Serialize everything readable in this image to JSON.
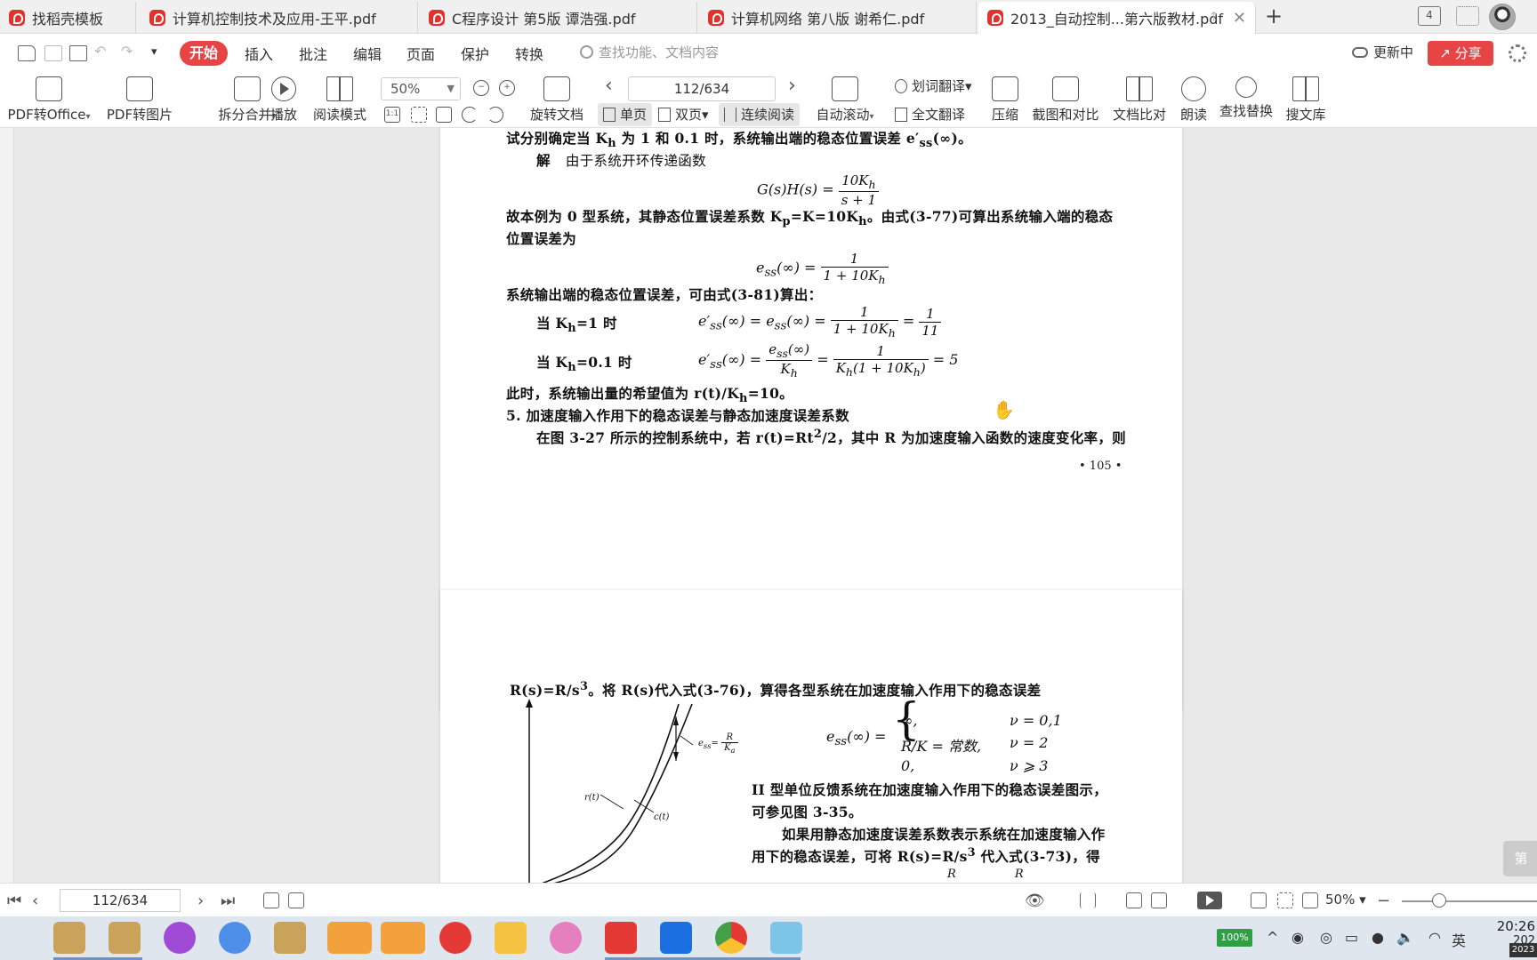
{
  "tabs": [
    {
      "title": "找稻壳模板",
      "active": false
    },
    {
      "title": "计算机控制技术及应用-王平.pdf",
      "active": false
    },
    {
      "title": "C程序设计 第5版 谭浩强.pdf",
      "active": false
    },
    {
      "title": "计算机网络 第八版 谢希仁.pdf",
      "active": false
    },
    {
      "title": "2013_自动控制...第六版教材.pdf",
      "active": true
    }
  ],
  "window": {
    "tab_count": "4"
  },
  "menu": {
    "items": [
      "开始",
      "插入",
      "批注",
      "编辑",
      "页面",
      "保护",
      "转换"
    ],
    "search_placeholder": "查找功能、文档内容",
    "updating": "更新中",
    "share": "分享"
  },
  "toolbar": {
    "pdf_to_office": "PDF转Office",
    "pdf_to_image": "PDF转图片",
    "split_merge": "拆分合并",
    "play": "播放",
    "read_mode": "阅读模式",
    "zoom": "50%",
    "rotate": "旋转文档",
    "page_indicator": "112/634",
    "single_page": "单页",
    "double_page": "双页",
    "continuous": "连续阅读",
    "auto_scroll": "自动滚动",
    "word_translate": "划词翻译",
    "full_translate": "全文翻译",
    "compress": "压缩",
    "screenshot_compare": "截图和对比",
    "doc_compare": "文档比对",
    "read_aloud": "朗读",
    "find_replace": "查找替换",
    "search_library": "搜文库"
  },
  "document": {
    "page1": {
      "line1": "试分别确定当 K",
      "line1b": "h",
      "line1c": " 为 1 和 0.1 时，系统输出端的稳态位置误差 e′",
      "line1d": "ss",
      "line1e": "(∞)。",
      "solution_label": "解",
      "solution_text": "由于系统开环传递函数",
      "eq1_lhs": "G(s)H(s) = ",
      "eq1_num": "10K",
      "eq1_den": "s + 1",
      "para2": "故本例为 0 型系统，其静态位置误差系数 K",
      "para2b": "p",
      "para2c": "=K=10K",
      "para2d": "h",
      "para2e": "。由式(3-77)可算出系统输入端的稳态",
      "para2_line2": "位置误差为",
      "eq2_lhs": "e",
      "eq2_sub": "ss",
      "eq2_mid": "(∞) = ",
      "eq2_num": "1",
      "eq2_den": "1 + 10K",
      "para3": "系统输出端的稳态位置误差，可由式(3-81)算出：",
      "case1_label": "当 K",
      "case1_cond": "=1 时",
      "case1_eq": "e′",
      "case1_eq2": "(∞) = e",
      "case1_eq3": "(∞) = ",
      "case1_num1": "1",
      "case1_den1": "1 + 10K",
      "case1_num2": "1",
      "case1_den2": "11",
      "case2_label": "当 K",
      "case2_cond": "=0.1 时",
      "case2_eq": "e′",
      "case2_eq2": "(∞) = ",
      "case2_num1": "e",
      "case2_num1b": "(∞)",
      "case2_den1": "K",
      "case2_num2": "1",
      "case2_den2": "K",
      "case2_den2b": "(1 + 10K",
      "case2_den2c": ")",
      "case2_result": " = 5",
      "para4": "此时，系统输出量的希望值为 r(t)/K",
      "para4b": "h",
      "para4c": "=10。",
      "section5": "5. 加速度输入作用下的稳态误差与静态加速度误差系数",
      "para5": "在图 3-27 所示的控制系统中，若 r(t)=Rt",
      "para5b": "2",
      "para5c": "/2，其中 R 为加速度输入函数的速度变化率，则",
      "page_number": "• 105 •"
    },
    "page2": {
      "line1": "R(s)=R/s",
      "line1b": "3",
      "line1c": "。将 R(s)代入式(3-76)，算得各型系统在加速度输入作用下的稳态误差",
      "eq_lhs": "e",
      "eq_sub": "ss",
      "eq_mid": "(∞) =",
      "case_a": "∞,",
      "case_a_cond": "ν = 0,1",
      "case_b": "R/K = 常数,",
      "case_b_cond": "ν = 2",
      "case_c": "0,",
      "case_c_cond": "ν ⩾ 3",
      "para_a": "II 型单位反馈系统在加速度输入作用下的稳态误差图示，",
      "para_a2": "可参见图 3-35。",
      "para_b": "如果用静态加速度误差系数表示系统在加速度输入作",
      "para_b2": "用下的稳态误差，可将 R(s)=R/s",
      "para_b2b": "3",
      "para_b2c": " 代入式(3-73)，得",
      "fig_r": "r(t)",
      "fig_c": "c(t)",
      "fig_ess": "e",
      "fig_ess_sub": "ss",
      "fig_ess_eq": "=",
      "fig_ess_num": "R",
      "fig_ess_den": "K",
      "fig_ess_den_sub": "a"
    }
  },
  "side_tab": "第",
  "statusbar": {
    "page": "112/634",
    "zoom": "50%"
  },
  "taskbar": {
    "battery": "100%",
    "ime": "英",
    "time": "20:26",
    "date": "202",
    "year_badge": "2023"
  }
}
